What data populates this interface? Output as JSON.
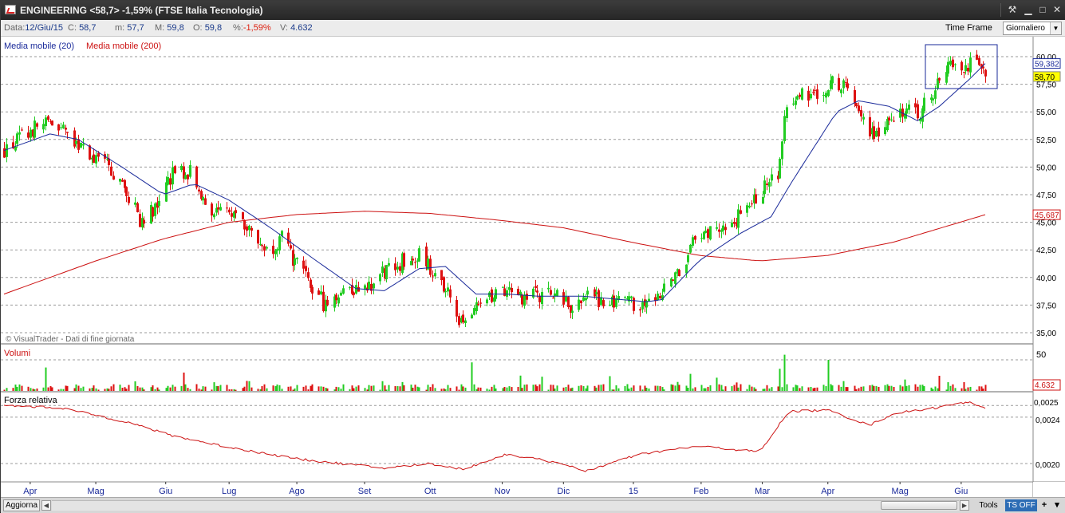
{
  "window": {
    "title": "ENGINEERING <58,7> -1,59% (FTSE Italia Tecnologia)",
    "controls": [
      "wrench",
      "minimize",
      "restore",
      "close"
    ]
  },
  "infobar": {
    "data_label": "Data:",
    "data_value": "12/Giu/15",
    "c_label": "C:",
    "c_value": "58,7",
    "m_label": "m:",
    "m_value": "57,7",
    "M_label": "M:",
    "M_value": "59,8",
    "o_label": "O:",
    "o_value": "59,8",
    "pct_label": "%:",
    "pct_value": "-1,59%",
    "v_label": "V:",
    "v_value": "4.632",
    "timeframe_label": "Time Frame",
    "timeframe_value": "Giornaliero"
  },
  "price_panel": {
    "legend_ma20": "Media mobile (20)",
    "legend_ma200": "Media mobile (200)",
    "watermark": "© VisualTrader - Dati di fine giornata",
    "y_ticks": [
      "60,00",
      "57,50",
      "55,00",
      "52,50",
      "50,00",
      "47,50",
      "45,00",
      "42,50",
      "40,00",
      "37,50",
      "35,00"
    ],
    "tag_ma20": "59,382",
    "tag_last": "58,70",
    "tag_ma200": "45,687"
  },
  "volume_panel": {
    "title": "Volumi",
    "y_tick": "50",
    "tag_last": "4.632"
  },
  "rs_panel": {
    "title": "Forza relativa",
    "y_ticks": [
      "0,0025",
      "0,0024",
      "0,0020"
    ]
  },
  "x_axis": {
    "labels": [
      "Apr",
      "Mag",
      "Giu",
      "Lug",
      "Ago",
      "Set",
      "Ott",
      "Nov",
      "Dic",
      "15",
      "Feb",
      "Mar",
      "Apr",
      "Mag",
      "Giu"
    ]
  },
  "bottombar": {
    "refresh_label": "Aggiorna",
    "tools_label": "Tools",
    "ts_label": "TS OFF",
    "plus_label": "+",
    "menu_label": "▾"
  },
  "colors": {
    "up": "#22cc22",
    "down": "#dd1111",
    "ma20": "#1a2a9a",
    "ma200": "#cc1111",
    "grid": "#9a9a9a",
    "tag_last_bg": "#ffff00"
  },
  "chart_data": {
    "type": "candlestick",
    "period": "2014-03 to 2015-06-12, daily",
    "ylim": [
      34.0,
      61.5
    ],
    "price_anchors": [
      [
        "2014-03-20",
        51.5
      ],
      [
        "2014-04-03",
        53.5
      ],
      [
        "2014-04-10",
        54.0
      ],
      [
        "2014-04-23",
        52.0
      ],
      [
        "2014-05-07",
        50.0
      ],
      [
        "2014-05-15",
        47.5
      ],
      [
        "2014-05-22",
        45.0
      ],
      [
        "2014-05-30",
        47.0
      ],
      [
        "2014-06-05",
        49.5
      ],
      [
        "2014-06-13",
        49.5
      ],
      [
        "2014-06-19",
        47.0
      ],
      [
        "2014-06-26",
        45.5
      ],
      [
        "2014-07-04",
        46.5
      ],
      [
        "2014-07-11",
        44.0
      ],
      [
        "2014-07-18",
        42.5
      ],
      [
        "2014-07-25",
        43.5
      ],
      [
        "2014-08-01",
        41.0
      ],
      [
        "2014-08-08",
        39.0
      ],
      [
        "2014-08-14",
        37.5
      ],
      [
        "2014-08-22",
        39.0
      ],
      [
        "2014-09-01",
        39.0
      ],
      [
        "2014-09-10",
        40.5
      ],
      [
        "2014-09-18",
        41.5
      ],
      [
        "2014-09-26",
        42.0
      ],
      [
        "2014-10-03",
        40.5
      ],
      [
        "2014-10-09",
        38.5
      ],
      [
        "2014-10-16",
        35.5
      ],
      [
        "2014-10-22",
        37.0
      ],
      [
        "2014-10-29",
        38.5
      ],
      [
        "2014-11-05",
        38.5
      ],
      [
        "2014-11-13",
        37.8
      ],
      [
        "2014-11-20",
        38.5
      ],
      [
        "2014-11-28",
        38.5
      ],
      [
        "2014-12-05",
        37.2
      ],
      [
        "2014-12-12",
        38.5
      ],
      [
        "2014-12-19",
        37.8
      ],
      [
        "2014-12-30",
        37.5
      ],
      [
        "2015-01-09",
        38.0
      ],
      [
        "2015-01-15",
        38.5
      ],
      [
        "2015-01-22",
        40.5
      ],
      [
        "2015-01-29",
        43.0
      ],
      [
        "2015-02-05",
        44.0
      ],
      [
        "2015-02-12",
        45.0
      ],
      [
        "2015-02-19",
        45.5
      ],
      [
        "2015-02-26",
        47.0
      ],
      [
        "2015-03-05",
        48.5
      ],
      [
        "2015-03-10",
        50.0
      ],
      [
        "2015-03-13",
        56.0
      ],
      [
        "2015-03-19",
        56.5
      ],
      [
        "2015-03-26",
        56.8
      ],
      [
        "2015-04-02",
        57.5
      ],
      [
        "2015-04-09",
        57.8
      ],
      [
        "2015-04-15",
        55.0
      ],
      [
        "2015-04-22",
        53.0
      ],
      [
        "2015-04-29",
        54.5
      ],
      [
        "2015-05-06",
        55.5
      ],
      [
        "2015-05-12",
        54.5
      ],
      [
        "2015-05-19",
        57.0
      ],
      [
        "2015-05-26",
        59.5
      ],
      [
        "2015-06-02",
        59.0
      ],
      [
        "2015-06-08",
        59.5
      ],
      [
        "2015-06-12",
        58.7
      ]
    ],
    "ma20_anchors": [
      [
        "2014-03-20",
        51.5
      ],
      [
        "2014-04-10",
        53.0
      ],
      [
        "2014-04-23",
        52.5
      ],
      [
        "2014-05-13",
        50.0
      ],
      [
        "2014-06-01",
        47.5
      ],
      [
        "2014-06-15",
        48.5
      ],
      [
        "2014-07-01",
        47.0
      ],
      [
        "2014-07-20",
        44.5
      ],
      [
        "2014-08-10",
        41.5
      ],
      [
        "2014-08-28",
        39.0
      ],
      [
        "2014-09-10",
        38.8
      ],
      [
        "2014-09-26",
        40.8
      ],
      [
        "2014-10-08",
        41.0
      ],
      [
        "2014-10-22",
        38.5
      ],
      [
        "2014-11-05",
        38.5
      ],
      [
        "2014-11-20",
        38.3
      ],
      [
        "2014-12-10",
        38.3
      ],
      [
        "2015-01-08",
        37.8
      ],
      [
        "2015-01-15",
        38.0
      ],
      [
        "2015-02-01",
        41.5
      ],
      [
        "2015-02-20",
        44.0
      ],
      [
        "2015-03-06",
        45.5
      ],
      [
        "2015-03-15",
        48.5
      ],
      [
        "2015-04-05",
        55.0
      ],
      [
        "2015-04-15",
        56.0
      ],
      [
        "2015-04-29",
        55.5
      ],
      [
        "2015-05-12",
        54.2
      ],
      [
        "2015-05-22",
        55.5
      ],
      [
        "2015-06-05",
        58.0
      ],
      [
        "2015-06-12",
        59.38
      ]
    ],
    "ma200_anchors": [
      [
        "2014-03-20",
        38.5
      ],
      [
        "2014-05-01",
        41.5
      ],
      [
        "2014-06-01",
        43.5
      ],
      [
        "2014-07-01",
        45.0
      ],
      [
        "2014-08-01",
        45.7
      ],
      [
        "2014-09-01",
        46.0
      ],
      [
        "2014-10-01",
        45.8
      ],
      [
        "2014-11-01",
        45.2
      ],
      [
        "2014-12-01",
        44.5
      ],
      [
        "2015-01-01",
        43.2
      ],
      [
        "2015-02-01",
        42.0
      ],
      [
        "2015-03-01",
        41.5
      ],
      [
        "2015-04-01",
        42.0
      ],
      [
        "2015-05-01",
        43.2
      ],
      [
        "2015-06-12",
        45.687
      ]
    ],
    "rs_anchors": [
      [
        "2014-03-20",
        0.0025
      ],
      [
        "2014-04-15",
        0.00248
      ],
      [
        "2014-05-15",
        0.00236
      ],
      [
        "2014-06-05",
        0.00224
      ],
      [
        "2014-07-01",
        0.00214
      ],
      [
        "2014-08-01",
        0.00204
      ],
      [
        "2014-09-10",
        0.00196
      ],
      [
        "2014-10-01",
        0.002
      ],
      [
        "2014-10-16",
        0.00195
      ],
      [
        "2014-11-05",
        0.00208
      ],
      [
        "2014-12-01",
        0.002
      ],
      [
        "2014-12-10",
        0.00193
      ],
      [
        "2015-01-05",
        0.00208
      ],
      [
        "2015-02-01",
        0.00215
      ],
      [
        "2015-03-01",
        0.0021
      ],
      [
        "2015-03-14",
        0.00245
      ],
      [
        "2015-04-01",
        0.00246
      ],
      [
        "2015-04-20",
        0.00233
      ],
      [
        "2015-05-01",
        0.00243
      ],
      [
        "2015-05-20",
        0.00248
      ],
      [
        "2015-06-05",
        0.00253
      ],
      [
        "2015-06-12",
        0.00248
      ]
    ],
    "volume_spikes": [
      [
        "2014-04-08",
        38
      ],
      [
        "2014-10-20",
        46
      ],
      [
        "2015-03-10",
        36
      ],
      [
        "2015-03-12",
        58
      ],
      [
        "2015-04-01",
        50
      ],
      [
        "2014-06-10",
        30
      ],
      [
        "2015-01-28",
        28
      ],
      [
        "2015-05-22",
        25
      ]
    ]
  }
}
